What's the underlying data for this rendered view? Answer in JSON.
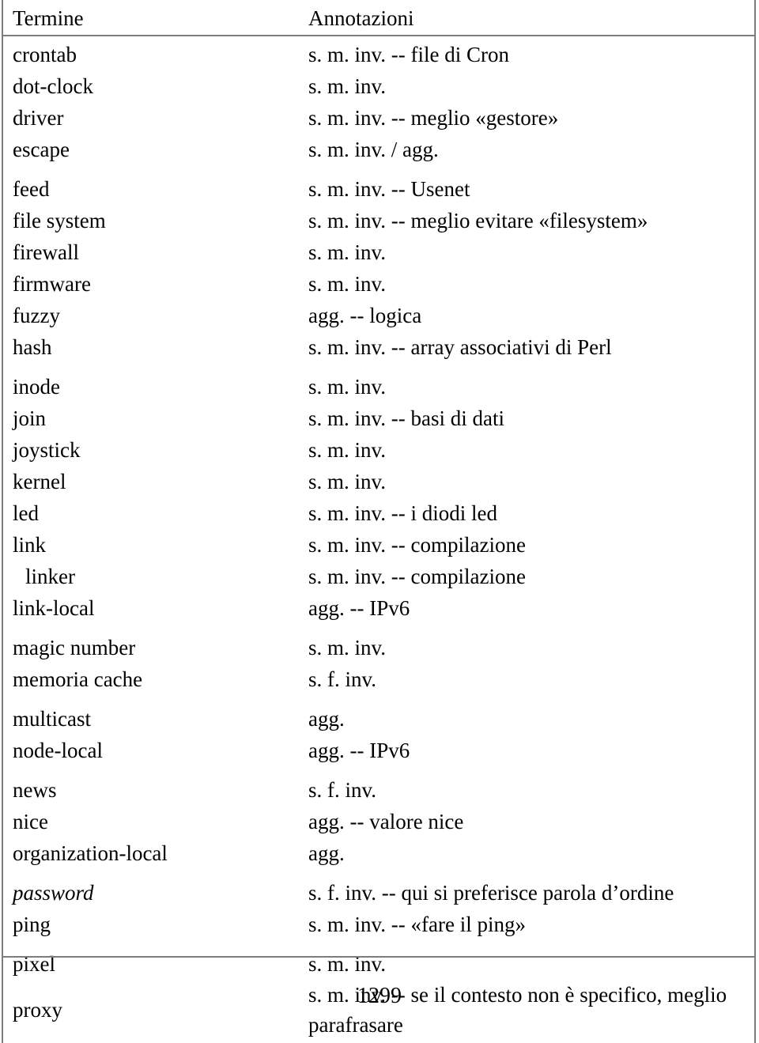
{
  "page": {
    "folio": "1299"
  },
  "table": {
    "headers": {
      "term": "Termine",
      "note": "Annotazioni"
    },
    "rows": [
      {
        "term": "crontab",
        "note": "s. m. inv. -- file di Cron"
      },
      {
        "term": "dot-clock",
        "note": "s. m. inv."
      },
      {
        "term": "driver",
        "note": "s. m. inv. -- meglio «gestore»"
      },
      {
        "term": "escape",
        "note": "s. m. inv. / agg."
      },
      {
        "term": "feed",
        "note": "s. m. inv. -- Usenet"
      },
      {
        "term": "file system",
        "note": "s. m. inv. -- meglio evitare «filesystem»"
      },
      {
        "term": "firewall",
        "note": "s. m. inv."
      },
      {
        "term": "firmware",
        "note": "s. m. inv."
      },
      {
        "term": "fuzzy",
        "note": "agg. -- logica"
      },
      {
        "term": "hash",
        "note": "s. m. inv. -- array associativi di Perl"
      },
      {
        "term": "inode",
        "note": "s. m. inv."
      },
      {
        "term": "join",
        "note": "s. m. inv. -- basi di dati"
      },
      {
        "term": "joystick",
        "note": "s. m. inv."
      },
      {
        "term": "kernel",
        "note": "s. m. inv."
      },
      {
        "term": "led",
        "note": "s. m. inv. -- i diodi led"
      },
      {
        "term": "link",
        "note": "s. m. inv. -- compilazione"
      },
      {
        "term": "linker",
        "note": "s. m. inv. -- compilazione"
      },
      {
        "term": "link-local",
        "note": "agg. -- IPv6"
      },
      {
        "term": "magic number",
        "note": "s. m. inv."
      },
      {
        "term": "memoria cache",
        "note": "s. f. inv."
      },
      {
        "term": "multicast",
        "note": "agg."
      },
      {
        "term": "node-local",
        "note": "agg. -- IPv6"
      },
      {
        "term": "news",
        "note": "s. f. inv."
      },
      {
        "term": "nice",
        "note": "agg. -- valore nice"
      },
      {
        "term": "organization-local",
        "note": "agg."
      },
      {
        "term": "password",
        "note": "s. f. inv. -- qui si preferisce parola d’ordine"
      },
      {
        "term": "ping",
        "note": "s. m. inv. -- «fare il ping»"
      },
      {
        "term": "pixel",
        "note": "s. m. inv."
      },
      {
        "term": "proxy",
        "note": "s. m. inv. -- se il contesto non è specifico, meglio parafrasare"
      }
    ]
  }
}
